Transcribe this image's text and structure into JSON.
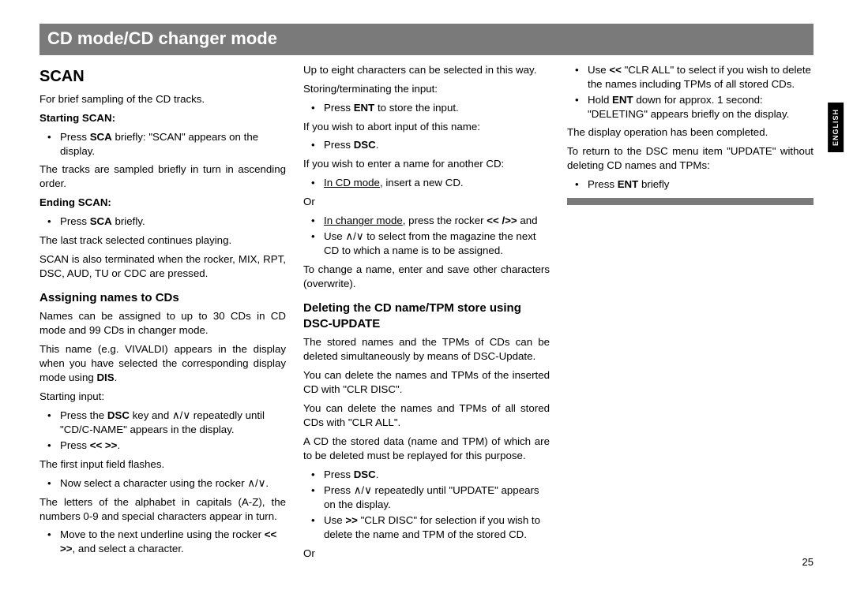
{
  "banner": "CD mode/CD changer mode",
  "sideTab": "ENGLISH",
  "pageNumber": "25",
  "scan": {
    "title": "Scan",
    "intro": "For brief sampling of the CD tracks.",
    "start": {
      "heading": "Starting SCAN:",
      "bullet_pre": "Press ",
      "bullet_bold": "SCA",
      "bullet_post": " briefly: \"SCAN\" appears on the display.",
      "after": "The tracks are sampled briefly in turn in ascending order."
    },
    "end": {
      "heading": "Ending SCAN:",
      "bullet_pre": "Press ",
      "bullet_bold": "SCA",
      "bullet_post": " briefly.",
      "after1": "The last track selected continues playing.",
      "after2": "SCAN is also terminated when the rocker, MIX, RPT, DSC, AUD, TU or CDC are pressed."
    }
  },
  "assign": {
    "title": "Assigning names to CDs",
    "p1": "Names can be assigned to up to 30 CDs in CD mode and 99 CDs in changer mode.",
    "p2_pre": "This name (e.g. VIVALDI) appears in the display when you have selected the corresponding display mode using ",
    "p2_bold": "DIS",
    "p2_post": ".",
    "startInput": "Starting input:",
    "li1_pre": "Press the ",
    "li1_bold": "DSC",
    "li1_mid": " key and ",
    "li1_post": " repeatedly until \"CD/C-NAME\" appears in the display.",
    "li2_pre": "Press ",
    "li2_bold": "<< >>",
    "li2_post": ".",
    "firstField": "The first input field flashes.",
    "li3_pre": "Now select a character using the rocker ",
    "li3_post": ".",
    "charsPara": "The letters of the alphabet in capitals (A-Z), the numbers 0-9 and special characters appear in turn.",
    "li4_pre": "Move to the next underline using the rocker ",
    "li4_bold": "<< >>",
    "li4_post": ", and select a character.",
    "uptoEight": "Up to eight characters can be selected in this way.",
    "storeTerm": "Storing/terminating the input:",
    "liEnt_pre": "Press ",
    "liEnt_bold": "ENT",
    "liEnt_post": " to store the input.",
    "abort": "If you wish to abort input of this name:",
    "liDsc_pre": "Press ",
    "liDsc_bold": "DSC",
    "liDsc_post": ".",
    "anotherCD": "If you wish to enter a name for another CD:",
    "liInCd_under": "In CD mode",
    "liInCd_post": ", insert a new CD.",
    "or": "Or",
    "liChanger_under": "In changer mode",
    "liChanger_mid": ", press the rocker ",
    "liChanger_bold": "<< />>",
    "liChanger_post": " and",
    "liUse_pre": "Use ",
    "liUse_post": " to select from the magazine the next CD to which a name is to be assigned.",
    "changeName": "To change a name, enter and save other characters (overwrite)."
  },
  "delete": {
    "title": "Deleting the CD name/TPM store using DSC-UPDATE",
    "p1": "The stored names and the TPMs of CDs can be deleted simultaneously by means of DSC-Update.",
    "p2": "You can delete the names and TPMs of the inserted CD with \"CLR DISC\".",
    "p3": "You can delete the names and TPMs of all stored CDs with \"CLR ALL\".",
    "p4": "A CD the stored data (name and TPM) of which are to be deleted must be replayed for this purpose.",
    "liDsc_pre": "Press ",
    "liDsc_bold": "DSC",
    "liDsc_post": ".",
    "liRep_pre": "Press ",
    "liRep_post": " repeatedly until \"UPDATE\" appears on the display.",
    "liClrDisc_pre": "Use ",
    "liClrDisc_bold": ">>",
    "liClrDisc_post": " \"CLR DISC\" for selection if you wish to delete the name and TPM of the stored CD.",
    "or": "Or",
    "liClrAll_pre": "Use ",
    "liClrAll_bold": "<<",
    "liClrAll_post": " \"CLR ALL\" to select if you wish to delete the names including TPMs of all stored CDs.",
    "liHold_pre": "Hold ",
    "liHold_bold": "ENT",
    "liHold_post": " down for approx. 1 second: \"DELETING\" appears briefly on the display.",
    "afterDel": "The display operation has been completed.",
    "return": "To return to the DSC menu item \"UPDATE\" without deleting CD names and TPMs:",
    "liEnt_pre": "Press ",
    "liEnt_bold": "ENT",
    "liEnt_post": " briefly"
  },
  "symbols": {
    "upDown": "∧/∨"
  }
}
